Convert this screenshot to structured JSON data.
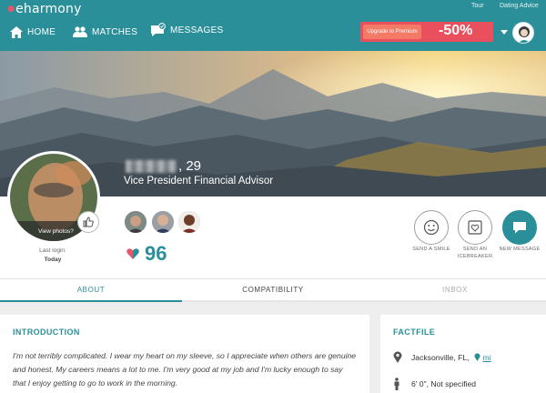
{
  "brand": {
    "name": "eharmony"
  },
  "top_links": {
    "tour": "Tour",
    "dating_advice": "Dating Advice"
  },
  "nav": {
    "home": "HOME",
    "matches": "MATCHES",
    "messages": "MESSAGES"
  },
  "upgrade": {
    "label": "Upgrade to Premium",
    "discount": "-50%"
  },
  "profile": {
    "age": ", 29",
    "title": "Vice President Financial Advisor",
    "view_photos": "View photos?",
    "last_login_label": "Last login:",
    "last_login_value": "Today",
    "compat_score": "96"
  },
  "actions": {
    "smile": "SEND A SMILE",
    "icebreaker_1": "SEND AN",
    "icebreaker_2": "ICEBREAKER",
    "message": "NEW MESSAGE"
  },
  "tabs": {
    "about": "ABOUT",
    "compatibility": "COMPATIBILITY",
    "inbox": "INBOX"
  },
  "intro": {
    "heading": "INTRODUCTION",
    "text": "I'm not terribly complicated. I wear my heart on my sleeve, so I appreciate when others are genuine and honest. My careers means a lot to me. I'm very good at my job and I'm lucky enough to say that I enjoy getting to go to work in the morning."
  },
  "factfile": {
    "heading": "FACTFILE",
    "location": "Jacksonville, FL,",
    "distance": "mi",
    "height": "6' 0\", Not specified"
  },
  "colors": {
    "brand": "#2a8f99",
    "upgrade": "#e94f5d",
    "heart": "#e9546b"
  }
}
